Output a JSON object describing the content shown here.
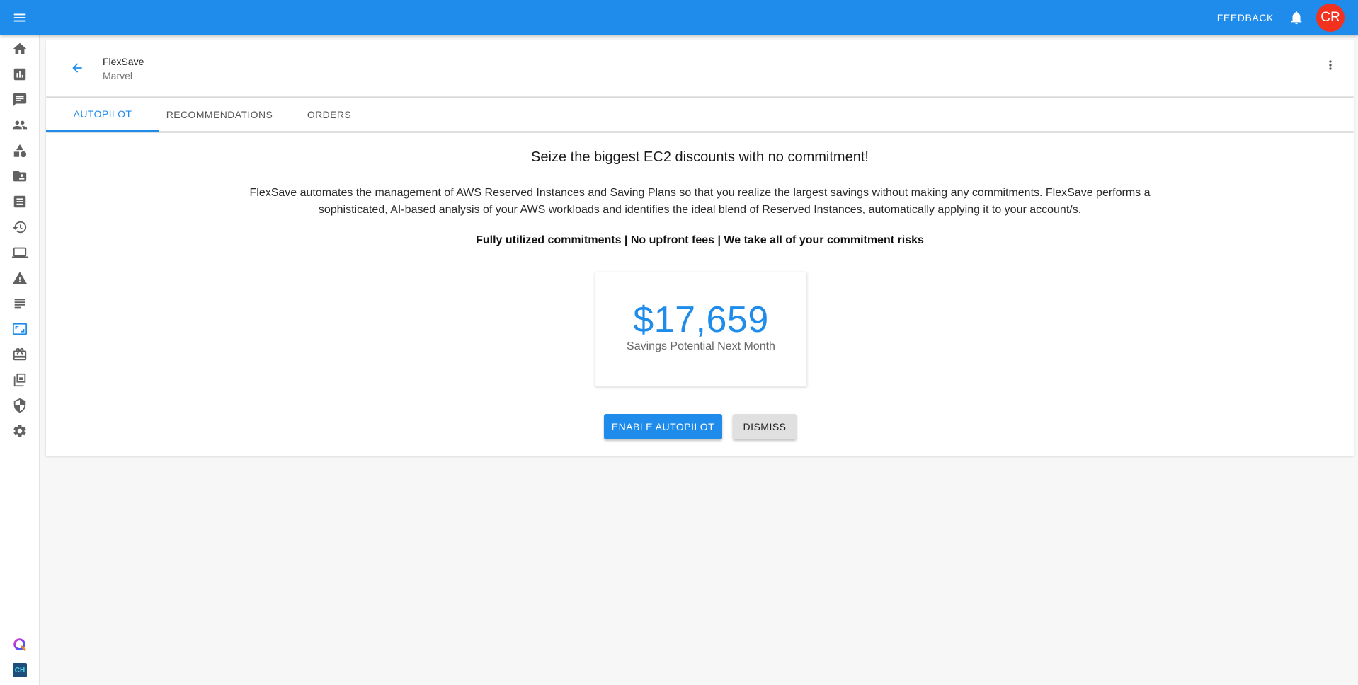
{
  "appbar": {
    "menu_icon": "menu-icon",
    "feedback_label": "FEEDBACK",
    "bell_icon": "bell-icon",
    "avatar_initials": "CR",
    "colors": {
      "bar": "#1f8ceb",
      "avatar": "#f2311e"
    }
  },
  "sidebar": {
    "items": [
      {
        "icon": "home-icon"
      },
      {
        "icon": "bar-chart-icon"
      },
      {
        "icon": "chat-icon"
      },
      {
        "icon": "people-icon"
      },
      {
        "icon": "category-icon"
      },
      {
        "icon": "contact-folder-icon"
      },
      {
        "icon": "receipt-icon"
      },
      {
        "icon": "history-icon"
      },
      {
        "icon": "laptop-icon"
      },
      {
        "icon": "warning-icon"
      },
      {
        "icon": "subject-icon"
      },
      {
        "icon": "aspect-ratio-icon",
        "active": true
      },
      {
        "icon": "store-icon"
      },
      {
        "icon": "dynamic-feed-icon"
      },
      {
        "icon": "shield-icon"
      },
      {
        "icon": "settings-icon"
      },
      {
        "icon": "q-logo-icon"
      },
      {
        "icon": "ch-logo-icon",
        "text": "CH"
      }
    ]
  },
  "header": {
    "title": "FlexSave",
    "subtitle": "Marvel",
    "back_icon": "arrow-back-icon",
    "more_icon": "more-vert-icon"
  },
  "tabs": [
    {
      "label": "AUTOPILOT",
      "active": true
    },
    {
      "label": "RECOMMENDATIONS",
      "active": false
    },
    {
      "label": "ORDERS",
      "active": false
    }
  ],
  "main": {
    "headline": "Seize the biggest EC2 discounts with no commitment!",
    "description": "FlexSave automates the management of AWS Reserved Instances and Saving Plans so that you realize the largest savings without making any commitments. FlexSave performs a sophisticated, AI-based analysis of your AWS workloads and identifies the ideal blend of Reserved Instances, automatically applying it to your account/s.",
    "tagline": "Fully utilized commitments | No upfront fees | We take all of your commitment risks",
    "savings": {
      "value": "$17,659",
      "label": "Savings Potential Next Month"
    },
    "buttons": {
      "enable_label": "ENABLE AUTOPILOT",
      "dismiss_label": "DISMISS"
    }
  }
}
